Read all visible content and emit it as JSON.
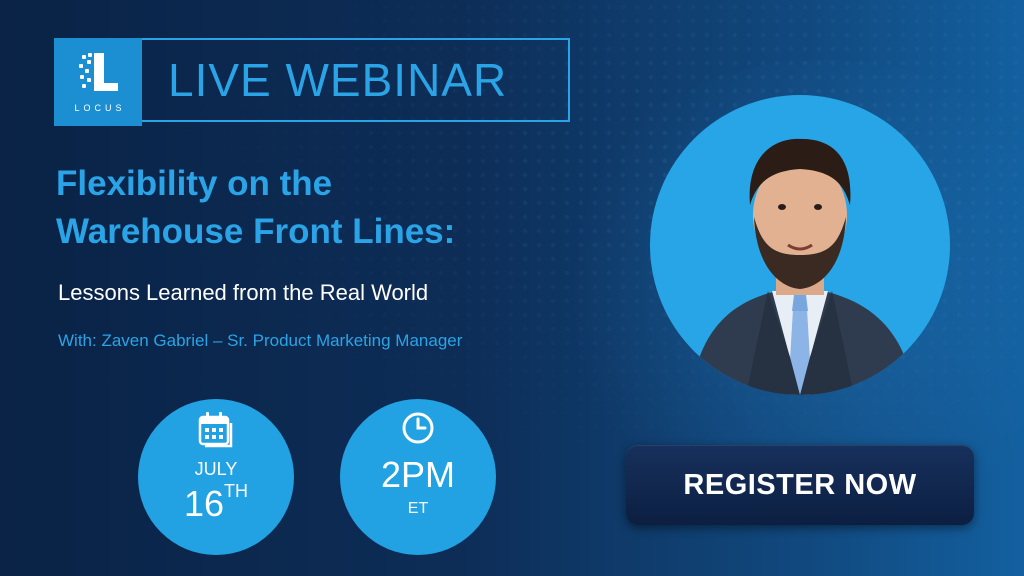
{
  "brand": {
    "logo_text": "LOCUS"
  },
  "banner": {
    "title": "LIVE WEBINAR"
  },
  "headline": {
    "line1": "Flexibility on the",
    "line2": "Warehouse Front Lines:",
    "subtitle": "Lessons Learned from the Real World"
  },
  "presenter": {
    "line": "With: Zaven Gabriel – Sr. Product Marketing Manager"
  },
  "date": {
    "month": "JULY",
    "day": "16",
    "suffix": "TH",
    "icon": "calendar-icon"
  },
  "time": {
    "value": "2PM",
    "zone": "ET",
    "icon": "clock-icon"
  },
  "cta": {
    "label": "REGISTER NOW"
  },
  "colors": {
    "accent": "#2aa4e6",
    "background": "#0d2d57",
    "circle": "#22a1e3",
    "button": "#132a52"
  }
}
